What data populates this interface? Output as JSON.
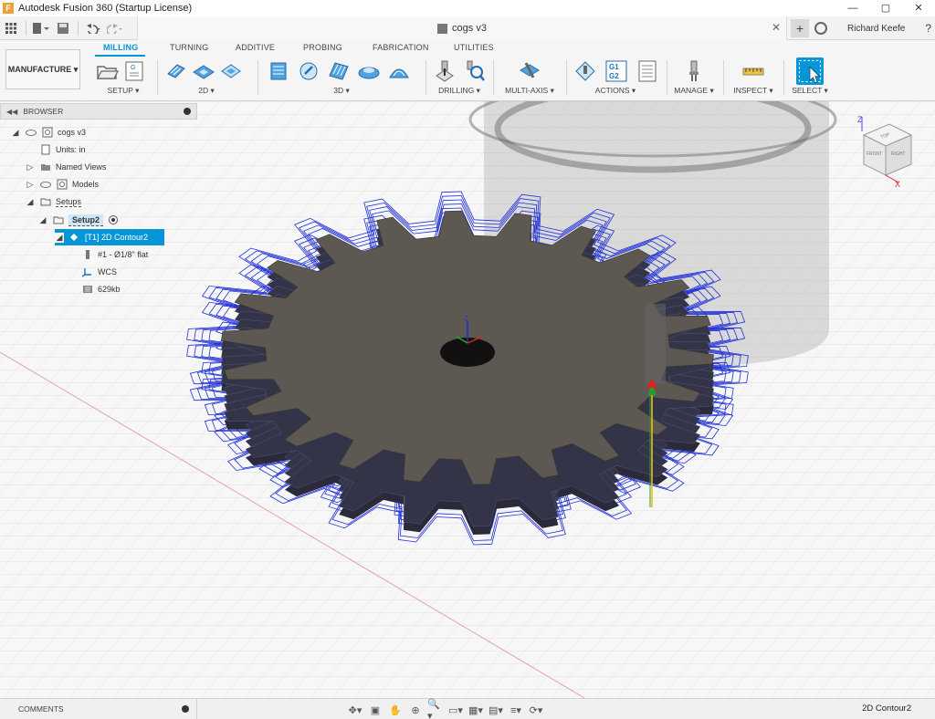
{
  "app": {
    "title": "Autodesk Fusion 360 (Startup License)",
    "window_buttons": [
      "—",
      "▢",
      "✕"
    ]
  },
  "document": {
    "name": "cogs v3",
    "user": "Richard Keefe"
  },
  "ribbon": {
    "workspace": "MANUFACTURE ▾",
    "tabs": [
      "MILLING",
      "TURNING",
      "ADDITIVE",
      "PROBING",
      "FABRICATION",
      "UTILITIES"
    ],
    "active_tab": "MILLING",
    "groups": [
      "SETUP ▾",
      "2D ▾",
      "3D ▾",
      "DRILLING ▾",
      "MULTI-AXIS ▾",
      "ACTIONS ▾",
      "MANAGE ▾",
      "INSPECT ▾",
      "SELECT ▾"
    ],
    "actions_icon_text": "G1\nG2"
  },
  "browser": {
    "header": "BROWSER",
    "items": [
      {
        "label": "cogs v3"
      },
      {
        "label": "Units: in"
      },
      {
        "label": "Named Views"
      },
      {
        "label": "Models"
      },
      {
        "label": "Setups"
      },
      {
        "label": "Setup2"
      },
      {
        "label": "[T1] 2D Contour2"
      },
      {
        "label": "#1 - Ø1/8\" flat"
      },
      {
        "label": "WCS"
      },
      {
        "label": "629kb"
      }
    ]
  },
  "viewcube": {
    "faces": [
      "TOP",
      "FRONT",
      "RIGHT"
    ],
    "axes": [
      "Z",
      "X"
    ]
  },
  "bottom": {
    "comments": "COMMENTS",
    "status": "2D Contour2"
  },
  "colors": {
    "accent": "#0696d7",
    "toolpath": "#1f2fd8",
    "gear": "#5e5853"
  }
}
